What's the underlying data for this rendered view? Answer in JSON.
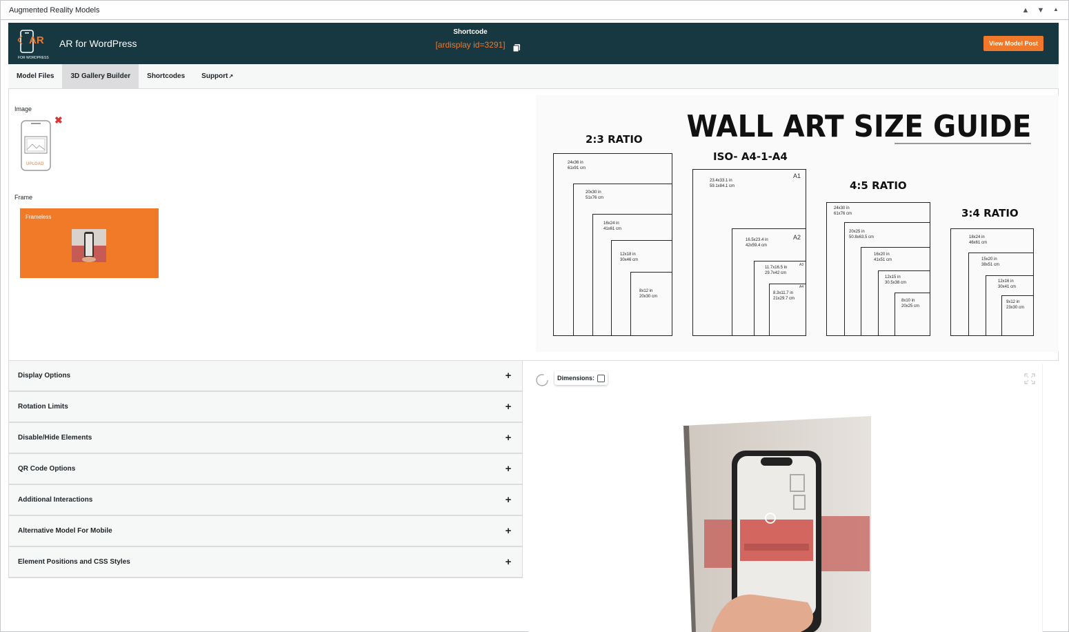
{
  "postbox": {
    "title": "Augmented Reality Models",
    "controls": [
      "▲",
      "▼",
      "▲"
    ]
  },
  "header": {
    "app_title": "AR for WordPress",
    "logo_text": "AR",
    "logo_subtext": "FOR WORDPRESS",
    "shortcode_label": "Shortcode",
    "shortcode_value": "[ardisplay id=3291]",
    "view_button": "View Model Post"
  },
  "tabs": [
    {
      "label": "Model Files"
    },
    {
      "label": "3D Gallery Builder",
      "active": true
    },
    {
      "label": "Shortcodes"
    },
    {
      "label": "Support",
      "external": "↗"
    }
  ],
  "gallery": {
    "image_label": "Image",
    "remove_symbol": "✖",
    "upload_text": "UPLOAD",
    "frame_label": "Frame",
    "frame_option": "Frameless"
  },
  "size_guide": {
    "title": "WALL ART SIZE GUIDE",
    "groups": [
      {
        "title": "2:3 RATIO",
        "sizes": [
          [
            "24x36 in",
            "61x91 cm"
          ],
          [
            "20x30 in",
            "51x76 cm"
          ],
          [
            "16x24 in",
            "41x61 cm"
          ],
          [
            "12x18 in",
            "30x46 cm"
          ],
          [
            "8x12 in",
            "20x30 cm"
          ]
        ]
      },
      {
        "title": "ISO- A4-1-A4",
        "sizes": [
          [
            "23.4x33.1 in",
            "59.1x84.1 cm"
          ],
          [
            "16.5x23.4 in",
            "42x59.4 cm"
          ],
          [
            "11.7x16.5 in",
            "29.7x42 cm"
          ],
          [
            "8.3x11.7 in",
            "21x29.7 cm"
          ]
        ],
        "tags": [
          "A1",
          "A2",
          "A3",
          "A4"
        ]
      },
      {
        "title": "4:5 RATIO",
        "sizes": [
          [
            "24x30 in",
            "61x76 cm"
          ],
          [
            "20x25 in",
            "50.8x63.5 cm"
          ],
          [
            "16x20 in",
            "41x51 cm"
          ],
          [
            "12x15 in",
            "30.5x38 cm"
          ],
          [
            "8x10 in",
            "20x25 cm"
          ]
        ]
      },
      {
        "title": "3:4 RATIO",
        "sizes": [
          [
            "18x24 in",
            "46x61 cm"
          ],
          [
            "15x20 in",
            "38x51 cm"
          ],
          [
            "12x16 in",
            "30x41 cm"
          ],
          [
            "9x12 in",
            "23x30 cm"
          ]
        ]
      }
    ]
  },
  "accordion": [
    {
      "label": "Display Options",
      "icon": "+"
    },
    {
      "label": "Rotation Limits",
      "icon": "+"
    },
    {
      "label": "Disable/Hide Elements",
      "icon": "+"
    },
    {
      "label": "QR Code Options",
      "icon": "+"
    },
    {
      "label": "Additional Interactions",
      "icon": "+"
    },
    {
      "label": "Alternative Model For Mobile",
      "icon": "+"
    },
    {
      "label": "Element Positions and CSS Styles",
      "icon": "+"
    }
  ],
  "viewer": {
    "dimensions_label": "Dimensions:",
    "dimensions_checked": false
  },
  "colors": {
    "header_bg": "#173741",
    "accent": "#f0782a",
    "frame_bg": "#f17a28",
    "remove": "#d63638"
  }
}
